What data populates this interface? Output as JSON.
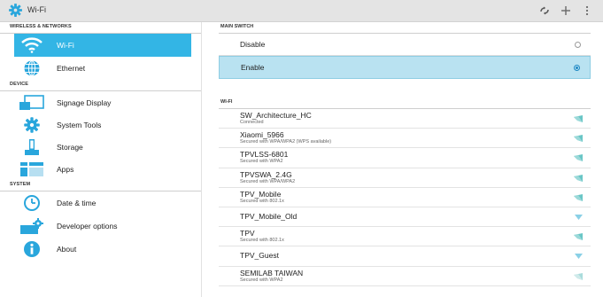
{
  "actionbar": {
    "title": "Wi-Fi",
    "icon": "gear-icon",
    "actions": [
      "wps-icon",
      "add-icon",
      "overflow-menu-icon"
    ]
  },
  "left": {
    "sections": [
      {
        "header": "WIRELESS & NETWORKS",
        "items": [
          {
            "label": "Wi-Fi",
            "icon": "wifi-icon",
            "selected": true
          },
          {
            "label": "Ethernet",
            "icon": "ethernet-globe-icon",
            "selected": false
          }
        ]
      },
      {
        "header": "DEVICE",
        "items": [
          {
            "label": "Signage Display",
            "icon": "display-icon",
            "selected": false
          },
          {
            "label": "System Tools",
            "icon": "gear-icon",
            "selected": false
          },
          {
            "label": "Storage",
            "icon": "storage-icon",
            "selected": false
          },
          {
            "label": "Apps",
            "icon": "apps-icon",
            "selected": false
          }
        ]
      },
      {
        "header": "SYSTEM",
        "items": [
          {
            "label": "Date & time",
            "icon": "clock-icon",
            "selected": false
          },
          {
            "label": "Developer options",
            "icon": "developer-icon",
            "selected": false
          },
          {
            "label": "About",
            "icon": "info-icon",
            "selected": false
          }
        ]
      }
    ]
  },
  "right": {
    "main_switch": {
      "header": "MAIN SWITCH",
      "options": [
        {
          "label": "Disable",
          "selected": false
        },
        {
          "label": "Enable",
          "selected": true
        }
      ]
    },
    "wifi": {
      "header": "WI-FI",
      "networks": [
        {
          "ssid": "SW_Architecture_HC",
          "status": "Connected"
        },
        {
          "ssid": "Xiaomi_5966",
          "status": "Secured with WPA/WPA2 (WPS available)"
        },
        {
          "ssid": "TPVLSS-6801",
          "status": "Secured with WPA2"
        },
        {
          "ssid": "TPVSWA_2.4G",
          "status": "Secured with WPA/WPA2"
        },
        {
          "ssid": "TPV_Mobile",
          "status": "Secured with 802.1x"
        },
        {
          "ssid": "TPV_Mobile_Old",
          "status": ""
        },
        {
          "ssid": "TPV",
          "status": "Secured with 802.1x"
        },
        {
          "ssid": "TPV_Guest",
          "status": ""
        },
        {
          "ssid": "SEMILAB TAIWAN",
          "status": "Secured with WPA2"
        }
      ]
    }
  },
  "colors": {
    "accent": "#33b5e5",
    "selected_row": "#b9e2f1",
    "icon_blue": "#29a6dc",
    "signal_teal": "#69c6c6",
    "actionbar": "#e4e4e4"
  }
}
